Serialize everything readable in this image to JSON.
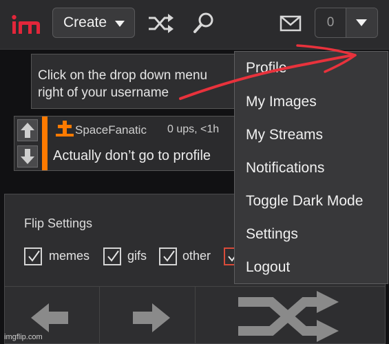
{
  "header": {
    "create_label": "Create",
    "notification_count": "0"
  },
  "hint": {
    "line1": "Click on the drop down menu",
    "line2": "right of your username"
  },
  "comment": {
    "username": "SpaceFanatic",
    "meta": "0 ups, <1h",
    "text": "Actually don’t go to profile"
  },
  "flip": {
    "title": "Flip Settings",
    "options": [
      "memes",
      "gifs",
      "other"
    ]
  },
  "menu": {
    "items": [
      "Profile",
      "My Images",
      "My Streams",
      "Notifications",
      "Toggle Dark Mode",
      "Settings",
      "Logout"
    ]
  },
  "watermark": "imgflip.com",
  "colors": {
    "accent_orange": "#ff7a00",
    "logo_red": "#e2263a",
    "annotation_red": "#e8323c"
  }
}
